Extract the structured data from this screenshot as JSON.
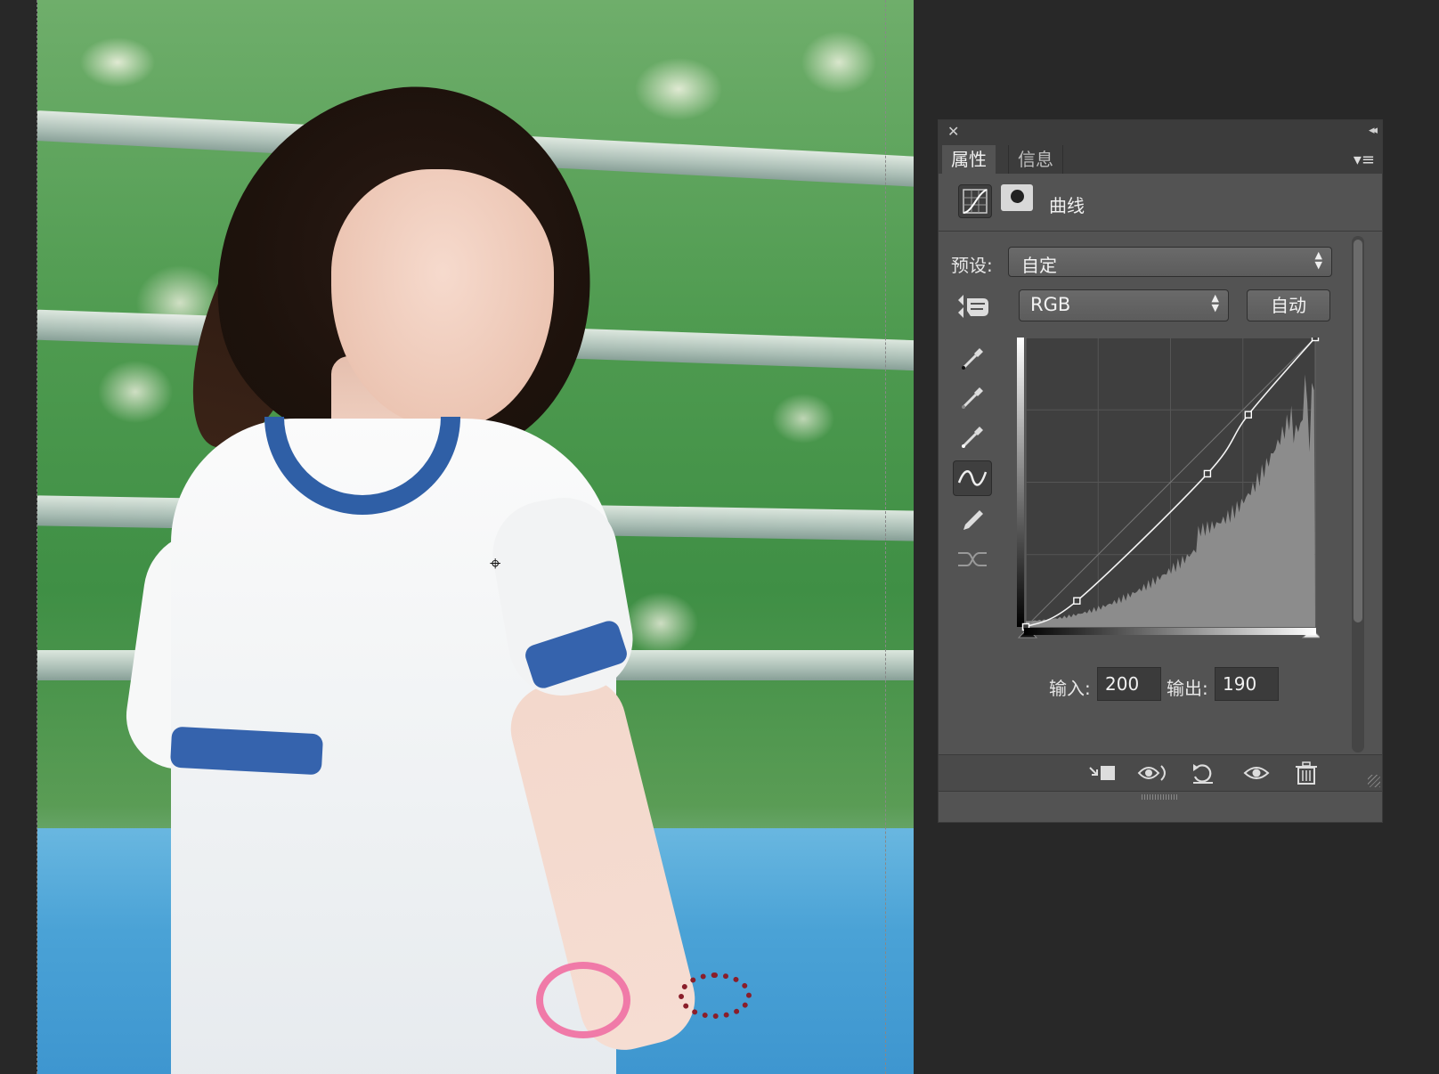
{
  "panel": {
    "tabs": [
      {
        "label": "属性"
      },
      {
        "label": "信息"
      }
    ],
    "adjustment_title": "曲线",
    "preset": {
      "label": "预设:",
      "value": "自定"
    },
    "channel": {
      "value": "RGB"
    },
    "auto_label": "自动",
    "input": {
      "label": "输入:",
      "value": "200"
    },
    "output": {
      "label": "输出:",
      "value": "190"
    }
  },
  "curve": {
    "range": [
      0,
      255
    ],
    "points": [
      [
        0,
        0
      ],
      [
        45,
        23
      ],
      [
        160,
        135
      ],
      [
        196,
        187
      ],
      [
        255,
        255
      ]
    ]
  },
  "icons": {
    "tools": [
      "target-adjustment-icon",
      "black-point-eyedropper-icon",
      "gray-point-eyedropper-icon",
      "white-point-eyedropper-icon",
      "curve-point-icon",
      "pencil-draw-icon",
      "smooth-curve-icon"
    ],
    "footer": [
      "clip-to-layer-icon",
      "view-previous-state-icon",
      "reset-icon",
      "visibility-eye-icon",
      "trash-icon"
    ]
  }
}
